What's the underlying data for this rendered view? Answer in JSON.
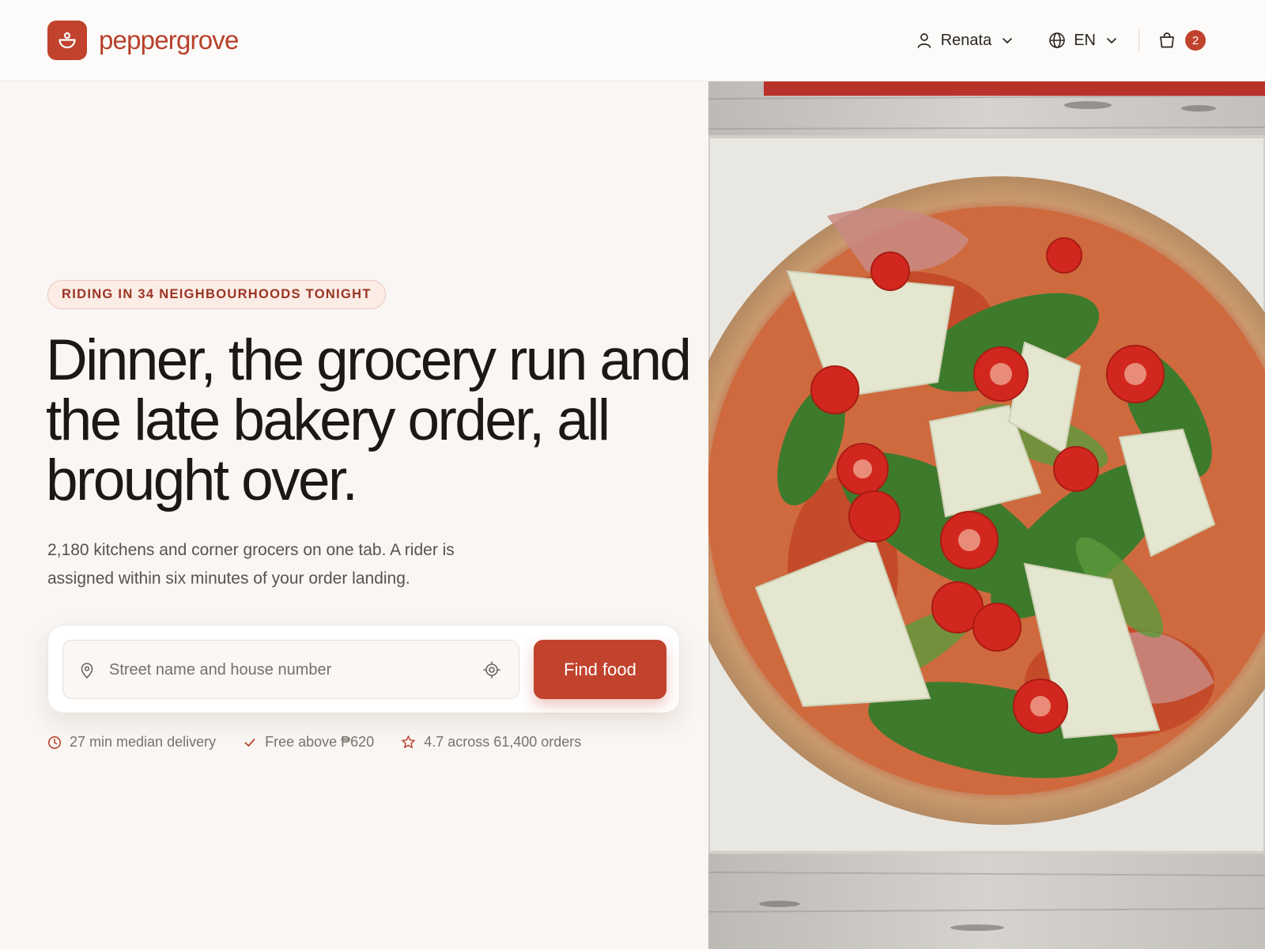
{
  "brand": {
    "name": "peppergrove",
    "color": "#c1432d"
  },
  "nav": {
    "user": {
      "icon": "user-icon",
      "label": "Renata"
    },
    "language": {
      "icon": "globe-icon",
      "label": "EN"
    },
    "cart": {
      "icon": "shopping-bag-icon",
      "count": "2"
    }
  },
  "hero": {
    "tag": "RIDING IN 34 NEIGHBOURHOODS TONIGHT",
    "headline": "Dinner, the grocery run and the late bakery order, all brought over.",
    "subcopy": "2,180 kitchens and corner grocers on one tab. A rider is assigned within six minutes of your order landing.",
    "search": {
      "placeholder": "Street name and house number",
      "value": "",
      "pin_icon": "map-pin-icon",
      "locate_icon": "locate-icon",
      "button_label": "Find food"
    },
    "stats": [
      {
        "icon": "clock-icon",
        "text": "27 min median delivery"
      },
      {
        "icon": "check-icon",
        "text": "Free above ₱620"
      },
      {
        "icon": "star-icon",
        "text": "4.7 across 61,400 orders"
      }
    ],
    "image": {
      "subject": "pizza-photo"
    }
  }
}
